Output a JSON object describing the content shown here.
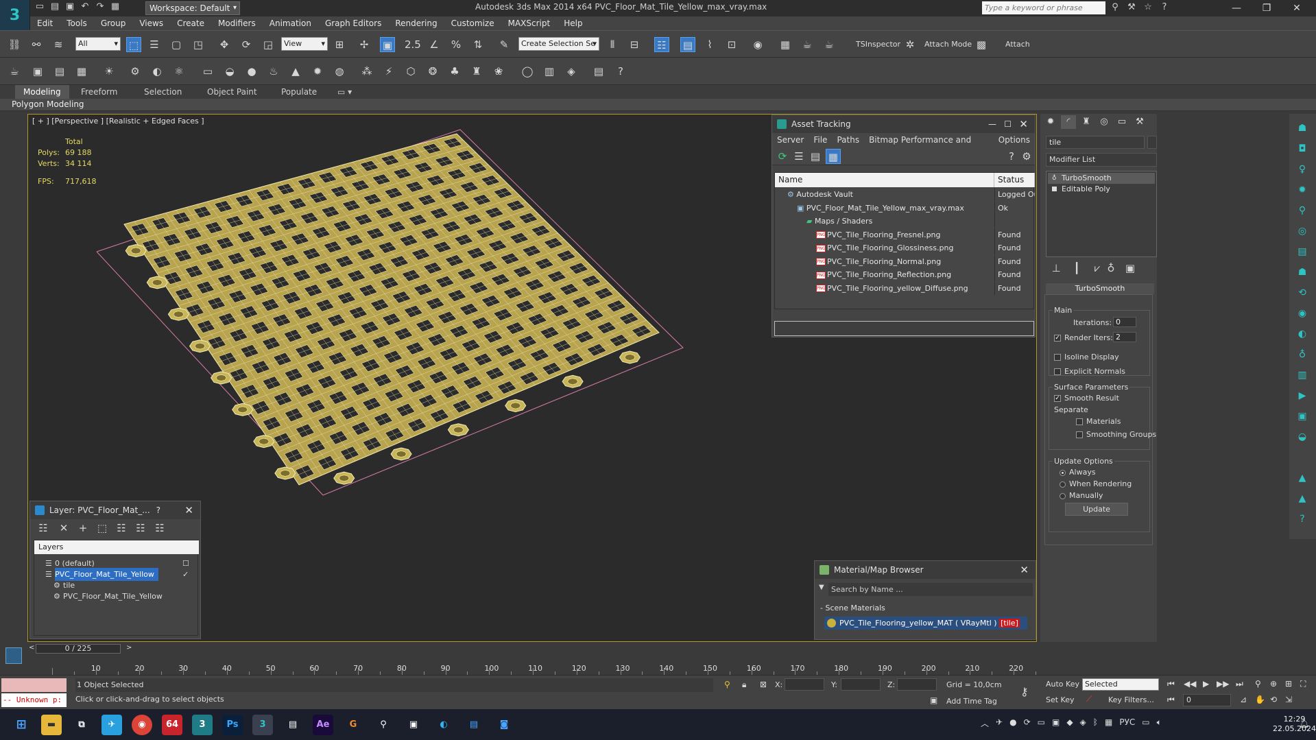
{
  "titlebar": {
    "workspace": "Workspace: Default",
    "title": "Autodesk 3ds Max  2014 x64     PVC_Floor_Mat_Tile_Yellow_max_vray.max",
    "search_placeholder": "Type a keyword or phrase"
  },
  "menu": [
    "Edit",
    "Tools",
    "Group",
    "Views",
    "Create",
    "Modifiers",
    "Animation",
    "Graph Editors",
    "Rendering",
    "Customize",
    "MAXScript",
    "Help"
  ],
  "toolbar": {
    "selection_filter": "All",
    "ref_coord": "View",
    "named_selection": "Create Selection Se",
    "tsinspector": "TSInspector",
    "attach_mode": "Attach Mode",
    "attach": "Attach",
    "snap_value": "2.5"
  },
  "ribbon": {
    "tabs": [
      "Modeling",
      "Freeform",
      "Selection",
      "Object Paint",
      "Populate"
    ],
    "active_tab": "Modeling",
    "sub_label": "Polygon Modeling"
  },
  "viewport": {
    "label": "[ + ] [Perspective ] [Realistic + Edged Faces ]",
    "stats_header": "Total",
    "polys_label": "Polys:",
    "polys": "69 188",
    "verts_label": "Verts:",
    "verts": "34 114",
    "fps_label": "FPS:",
    "fps": "717,618",
    "mesh_color": "#d8c76a",
    "bbox_color": "#d87aa8"
  },
  "asset_tracking": {
    "title": "Asset Tracking",
    "menu": [
      "Server",
      "File",
      "Paths",
      "Bitmap Performance and Memory",
      "Options"
    ],
    "col_name": "Name",
    "col_status": "Status",
    "rows": [
      {
        "name": "Autodesk Vault",
        "status": "Logged Ou",
        "indent": 1,
        "icon": "vault-icon"
      },
      {
        "name": "PVC_Floor_Mat_Tile_Yellow_max_vray.max",
        "status": "Ok",
        "indent": 2,
        "icon": "file-icon"
      },
      {
        "name": "Maps / Shaders",
        "status": "",
        "indent": 3,
        "icon": "maps-icon"
      },
      {
        "name": "PVC_Tile_Flooring_Fresnel.png",
        "status": "Found",
        "indent": 4,
        "icon": "png-icon"
      },
      {
        "name": "PVC_Tile_Flooring_Glossiness.png",
        "status": "Found",
        "indent": 4,
        "icon": "png-icon"
      },
      {
        "name": "PVC_Tile_Flooring_Normal.png",
        "status": "Found",
        "indent": 4,
        "icon": "png-icon"
      },
      {
        "name": "PVC_Tile_Flooring_Reflection.png",
        "status": "Found",
        "indent": 4,
        "icon": "png-icon"
      },
      {
        "name": "PVC_Tile_Flooring_yellow_Diffuse.png",
        "status": "Found",
        "indent": 4,
        "icon": "png-icon"
      }
    ]
  },
  "layer_dialog": {
    "title": "Layer: PVC_Floor_Mat_...",
    "help": "?",
    "header": "Layers",
    "rows": [
      {
        "name": "0 (default)",
        "indent": 1,
        "selected": false
      },
      {
        "name": "PVC_Floor_Mat_Tile_Yellow",
        "indent": 1,
        "selected": true
      },
      {
        "name": "tile",
        "indent": 2,
        "selected": false
      },
      {
        "name": "PVC_Floor_Mat_Tile_Yellow",
        "indent": 2,
        "selected": false
      }
    ]
  },
  "material_browser": {
    "title": "Material/Map Browser",
    "search_placeholder": "Search by Name ...",
    "group": "- Scene Materials",
    "material": "PVC_Tile_Flooring_yellow_MAT  ( VRayMtl )",
    "material_tag": "[tile]"
  },
  "command_panel": {
    "object_name": "tile",
    "modifier_list": "Modifier List",
    "stack": [
      "TurboSmooth",
      "Editable Poly"
    ],
    "rollout_title": "TurboSmooth",
    "main_group": "Main",
    "iterations_label": "Iterations:",
    "iterations": "0",
    "render_iters_label": "Render Iters:",
    "render_iters": "2",
    "render_iters_checked": true,
    "isoline_label": "Isoline Display",
    "explicit_normals_label": "Explicit Normals",
    "surface_group": "Surface Parameters",
    "smooth_result_label": "Smooth Result",
    "smooth_result_checked": true,
    "separate_label": "Separate",
    "materials_label": "Materials",
    "smoothing_groups_label": "Smoothing Groups",
    "update_group": "Update Options",
    "always_label": "Always",
    "when_rendering_label": "When Rendering",
    "manually_label": "Manually",
    "update_button": "Update",
    "update_option": "Always"
  },
  "timeline": {
    "slider": "0 / 225",
    "ticks": [
      10,
      20,
      30,
      40,
      50,
      60,
      70,
      80,
      90,
      100,
      110,
      120,
      130,
      140,
      150,
      160,
      170,
      180,
      190,
      200,
      210,
      220
    ],
    "max_frame": 225
  },
  "statusbar": {
    "maxscript": "-- Unknown p:",
    "selected": "1 Object Selected",
    "prompt": "Click or click-and-drag to select objects",
    "x_label": "X:",
    "y_label": "Y:",
    "z_label": "Z:",
    "grid": "Grid = 10,0cm",
    "add_time_tag": "Add Time Tag",
    "auto_key": "Auto Key",
    "set_key": "Set Key",
    "key_mode": "Selected",
    "key_filters": "Key Filters...",
    "frame": "0"
  },
  "taskbar": {
    "badge": "64",
    "lang": "РУС",
    "time": "12:29",
    "date": "22.05.2024"
  }
}
